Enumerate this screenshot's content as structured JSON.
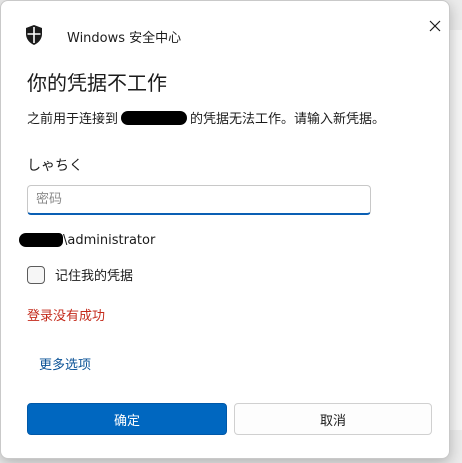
{
  "window": {
    "app_title": "Windows 安全中心",
    "close_icon": "close-icon",
    "shield_icon": "shield-icon"
  },
  "dialog": {
    "heading": "你的凭据不工作",
    "subtitle_before": "之前用于连接到",
    "subtitle_after": "的凭据无法工作。请输入新凭据。",
    "user_label": "しゃちく",
    "password": {
      "placeholder": "密码",
      "value": ""
    },
    "account_suffix": "\\administrator",
    "remember_label": "记住我的凭据",
    "remember_checked": false,
    "error_text": "登录没有成功",
    "more_options": "更多选项",
    "ok_label": "确定",
    "cancel_label": "取消"
  },
  "colors": {
    "accent": "#0067c0",
    "error": "#c42b1c",
    "link": "#0a5296"
  }
}
